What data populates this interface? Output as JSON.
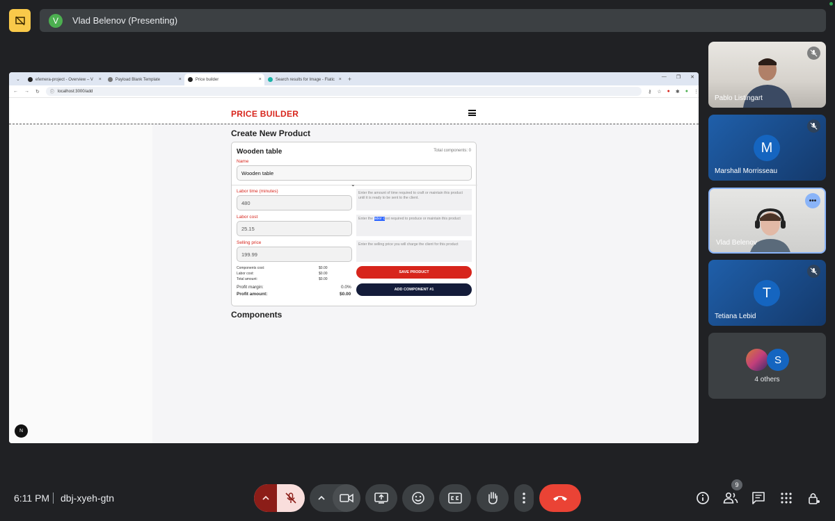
{
  "meeting": {
    "presenter_initial": "V",
    "presenter_label": "Vlad Belenov (Presenting)",
    "time": "6:11 PM",
    "code": "dbj-xyeh-gtn",
    "participants_count": "9"
  },
  "browser": {
    "tabs": [
      {
        "label": "efemera-project - Overview – V"
      },
      {
        "label": "Payload Blank Template"
      },
      {
        "label": "Price builder"
      },
      {
        "label": "Search results for Image - Flatic"
      }
    ],
    "url": "localhost:3000/add"
  },
  "app": {
    "brand": "PRICE BUILDER",
    "page_title": "Create New Product",
    "product_title": "Wooden table",
    "total_components": "Total components: 0",
    "name_label": "Name",
    "name_value": "Wooden table",
    "labor_time_label": "Labor time (minutes)",
    "labor_time_value": "480",
    "labor_time_hint": "Enter the amount of time required to craft or maintain this product until it is ready to be sent to the client.",
    "labor_cost_label": "Labor cost",
    "labor_cost_value": "25.15",
    "labor_cost_hint_pre": "Enter the ",
    "labor_cost_hint_hl": "labor c",
    "labor_cost_hint_post": "ost required to produce or maintain this product",
    "selling_price_label": "Selling price",
    "selling_price_value": "199.99",
    "selling_price_hint": "Enter the selling price you will charge the client for this product",
    "components_cost_label": "Components cost:",
    "components_cost_value": "$0.00",
    "labor_cost_sum_label": "Labor cost:",
    "labor_cost_sum_value": "$0.00",
    "total_amount_label": "Total amount:",
    "total_amount_value": "$0.00",
    "profit_margin_label": "Profit margin:",
    "profit_margin_value": "0.0%",
    "profit_amount_label": "Profit amount:",
    "profit_amount_value": "$0.00",
    "save_label": "SAVE PRODUCT",
    "add_component_label": "ADD COMPONENT #1",
    "components_title": "Components",
    "next_badge": "N"
  },
  "participants": [
    {
      "name": "Pablo Listingart",
      "muted": true
    },
    {
      "name": "Marshall Morrisseau",
      "initial": "M",
      "muted": true
    },
    {
      "name": "Vlad Belenov",
      "muted": false
    },
    {
      "name": "Tetiana Lebid",
      "initial": "T",
      "muted": true
    }
  ],
  "others": {
    "label": "4 others",
    "initial": "S"
  },
  "colors": {
    "brand_red": "#d7251c",
    "navy": "#141c3a",
    "meet_bg": "#202124",
    "end_call": "#ea4335"
  }
}
